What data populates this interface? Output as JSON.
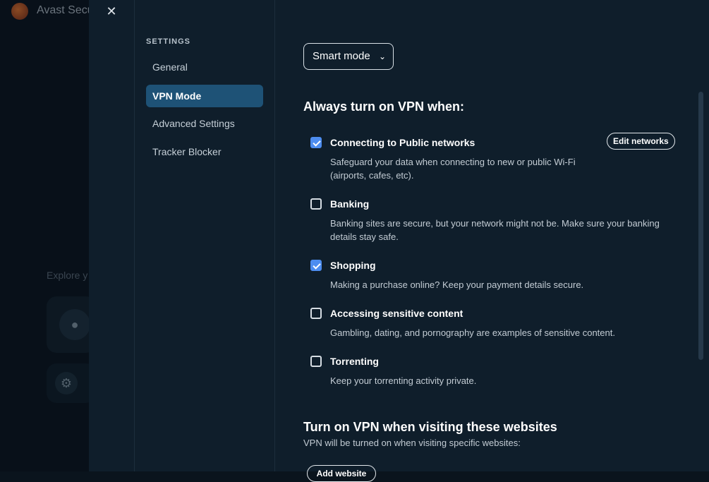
{
  "background_app": {
    "title": "Avast Secu",
    "explore_text": "Explore y"
  },
  "settings": {
    "close_icon": "close-icon",
    "nav_heading": "SETTINGS",
    "nav_items": [
      {
        "label": "General"
      },
      {
        "label": "VPN Mode"
      },
      {
        "label": "Advanced Settings"
      },
      {
        "label": "Tracker Blocker"
      }
    ],
    "active_nav": "VPN Mode"
  },
  "content": {
    "mode_select": {
      "value": "Smart mode"
    },
    "always_title": "Always turn on VPN when:",
    "edit_networks_label": "Edit networks",
    "options": [
      {
        "label": "Connecting to Public networks",
        "checked": true,
        "description": "Safeguard your data when connecting to new or public Wi-Fi (airports, cafes, etc)."
      },
      {
        "label": "Banking",
        "checked": false,
        "description": "Banking sites are secure, but your network might not be. Make sure your banking details stay safe."
      },
      {
        "label": "Shopping",
        "checked": true,
        "description": "Making a purchase online? Keep your payment details secure."
      },
      {
        "label": "Accessing sensitive content",
        "checked": false,
        "description": "Gambling, dating, and pornography are examples of sensitive content."
      },
      {
        "label": "Torrenting",
        "checked": false,
        "description": "Keep your torrenting activity private."
      }
    ],
    "websites_title": "Turn on VPN when visiting these websites",
    "websites_desc": "VPN will be turned on when visiting specific websites:",
    "add_site_label": "Add website"
  },
  "colors": {
    "panel_bg": "#0f1e2b",
    "active_nav_bg": "#1e5276",
    "checkbox_checked": "#4d8df0"
  }
}
